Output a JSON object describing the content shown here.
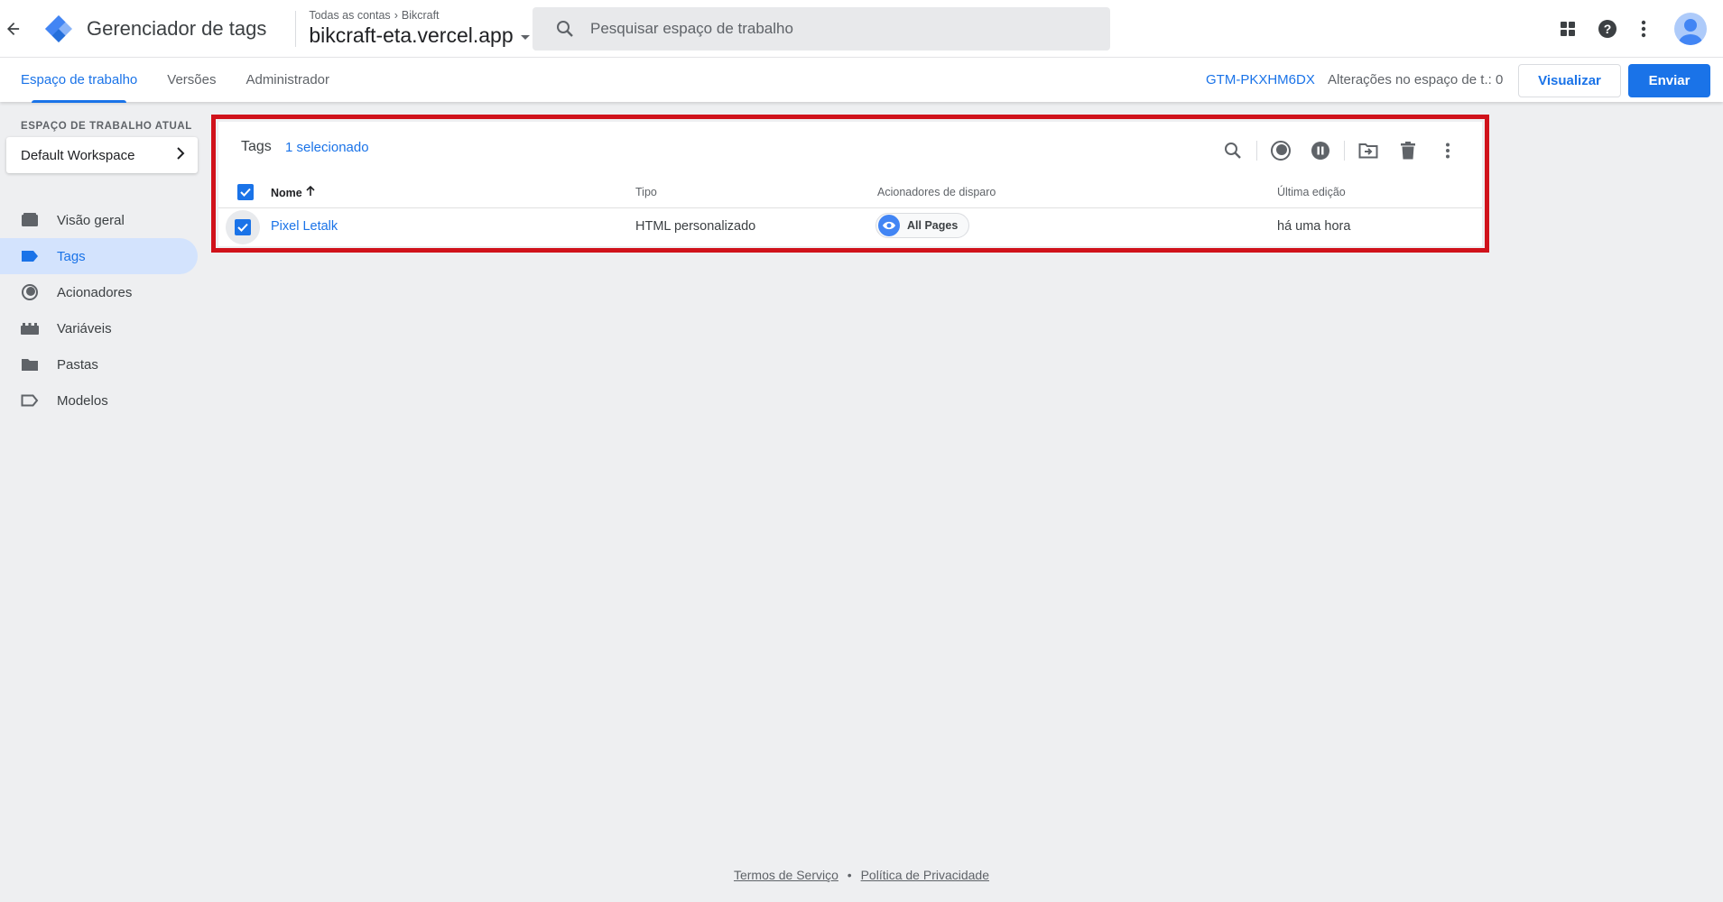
{
  "header": {
    "product_name": "Gerenciador de tags",
    "breadcrumb": [
      "Todas as contas",
      "Bikcraft"
    ],
    "container_name": "bikcraft-eta.vercel.app",
    "search_placeholder": "Pesquisar espaço de trabalho"
  },
  "subnav": {
    "tabs": [
      {
        "label": "Espaço de trabalho",
        "active": true
      },
      {
        "label": "Versões",
        "active": false
      },
      {
        "label": "Administrador",
        "active": false
      }
    ],
    "container_id": "GTM-PKXHM6DX",
    "workspace_changes": "Alterações no espaço de t.: 0",
    "preview_label": "Visualizar",
    "submit_label": "Enviar"
  },
  "sidebar": {
    "workspace_heading": "ESPAÇO DE TRABALHO ATUAL",
    "workspace_name": "Default Workspace",
    "items": [
      {
        "label": "Visão geral",
        "icon": "overview-icon",
        "active": false
      },
      {
        "label": "Tags",
        "icon": "tag-icon",
        "active": true
      },
      {
        "label": "Acionadores",
        "icon": "trigger-icon",
        "active": false
      },
      {
        "label": "Variáveis",
        "icon": "variable-icon",
        "active": false
      },
      {
        "label": "Pastas",
        "icon": "folder-icon",
        "active": false
      },
      {
        "label": "Modelos",
        "icon": "template-icon",
        "active": false
      }
    ]
  },
  "tags_table": {
    "title": "Tags",
    "selected_text": "1 selecionado",
    "columns": [
      "Nome",
      "Tipo",
      "Acionadores de disparo",
      "Última edição"
    ],
    "rows": [
      {
        "name": "Pixel Letalk",
        "type": "HTML personalizado",
        "trigger": "All Pages",
        "last_edit": "há uma hora",
        "selected": true
      }
    ]
  },
  "footer": {
    "terms": "Termos de Serviço",
    "separator": "•",
    "privacy": "Política de Privacidade"
  },
  "colors": {
    "accent": "#1a73e8",
    "highlight_border": "#d0121b",
    "active_nav_bg": "#d3e3fd"
  }
}
